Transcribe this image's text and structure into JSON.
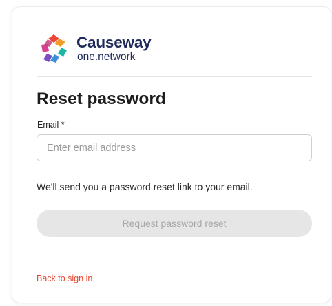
{
  "brand": {
    "name": "Causeway",
    "sub": "one.network",
    "colors": {
      "text": "#1f2a5a",
      "petal_red": "#e8473a",
      "petal_orange": "#f39a2b",
      "petal_teal": "#1bb7a4",
      "petal_blue": "#3a8fd8",
      "petal_purple": "#7b4fc4",
      "petal_pink": "#d9418f"
    }
  },
  "form": {
    "title": "Reset password",
    "email_label": "Email *",
    "email_placeholder": "Enter email address",
    "email_value": "",
    "hint": "We'll send you a password reset link to your email.",
    "submit_label": "Request password reset",
    "submit_state": "disabled"
  },
  "footer": {
    "back_link": "Back to sign in"
  },
  "colors": {
    "accent_link": "#e9452f",
    "button_disabled_bg": "#e6e6e6",
    "button_disabled_text": "#a8a8a8"
  }
}
